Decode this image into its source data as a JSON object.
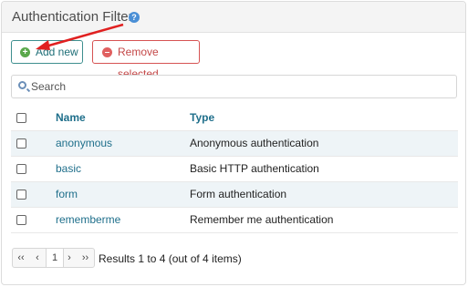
{
  "panel": {
    "title": "Authentication Filters"
  },
  "toolbar": {
    "add_label": "Add new",
    "remove_label": "Remove selected"
  },
  "search": {
    "placeholder": "Search"
  },
  "table": {
    "headers": {
      "name": "Name",
      "type": "Type"
    },
    "rows": [
      {
        "name": "anonymous",
        "type": "Anonymous authentication"
      },
      {
        "name": "basic",
        "type": "Basic HTTP authentication"
      },
      {
        "name": "form",
        "type": "Form authentication"
      },
      {
        "name": "rememberme",
        "type": "Remember me authentication"
      }
    ]
  },
  "pagination": {
    "first": "‹‹",
    "prev": "‹",
    "page": "1",
    "next": "›",
    "last": "››",
    "summary": "Results 1 to 4 (out of 4 items)"
  },
  "colors": {
    "link": "#1f6f8b",
    "add": "#5aa84b",
    "remove": "#e06060",
    "arrow": "#e02020"
  }
}
